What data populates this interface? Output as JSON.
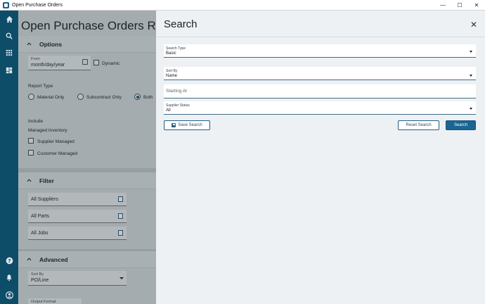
{
  "window": {
    "title": "Open Purchase Orders",
    "controls": {
      "minimize": "—",
      "maximize": "☐",
      "close": "✕"
    }
  },
  "rail": {
    "icons": [
      "home-icon",
      "search-icon",
      "apps-grid-icon",
      "dashboard-icon",
      "help-icon",
      "notifications-icon",
      "account-icon"
    ]
  },
  "report": {
    "title": "Open Purchase Orders Repo",
    "options": {
      "header": "Options",
      "from_label": "From",
      "from_value": "month/day/year",
      "dynamic_label": "Dynamic",
      "report_type_label": "Report Type",
      "report_types": [
        "Material Only",
        "Subcontract Only",
        "Both"
      ],
      "selected_report_type": "Both",
      "include_label": "Include",
      "managed_inventory_label": "Managed Inventory",
      "supplier_managed_label": "Supplier Managed",
      "customer_managed_label": "Customer Managed"
    },
    "filter": {
      "header": "Filter",
      "items": [
        "All Suppliers",
        "All Parts",
        "All Jobs"
      ]
    },
    "advanced": {
      "header": "Advanced",
      "sort_by_label": "Sort By",
      "sort_by_value": "PO/Line",
      "output_format_label": "Output Format"
    }
  },
  "search_panel": {
    "title": "Search",
    "close_icon": "✕",
    "search_type": {
      "label": "Search Type",
      "value": "Basic"
    },
    "sort_by": {
      "label": "Sort By",
      "value": "Name"
    },
    "starting_at": {
      "placeholder": "Starting At"
    },
    "supplier_status": {
      "label": "Supplier Status",
      "value": "All"
    },
    "buttons": {
      "save_search": "Save Search",
      "reset_search": "Reset Search",
      "search": "Search"
    },
    "colors": {
      "primary": "#1b6593",
      "background": "#eef1f4"
    }
  }
}
